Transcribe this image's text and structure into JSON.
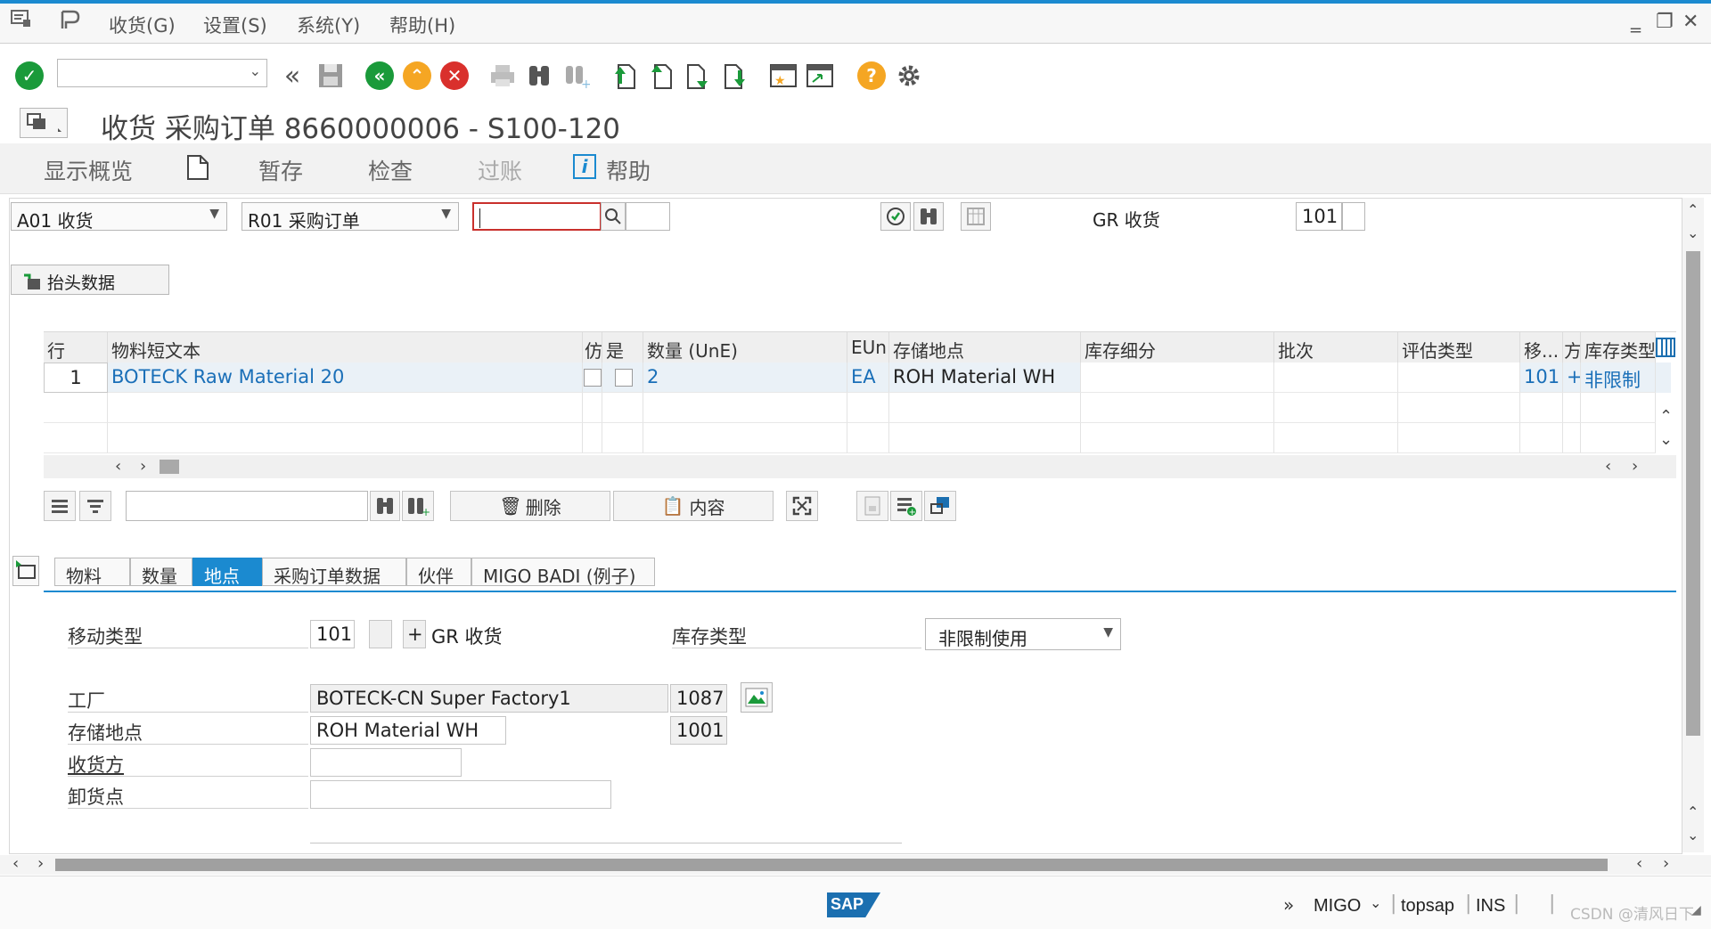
{
  "menu": {
    "items": [
      "收货(G)",
      "设置(S)",
      "系统(Y)",
      "帮助(H)"
    ]
  },
  "toolbar": {
    "command_value": "",
    "icons": [
      "enter-icon",
      "back-double-icon",
      "save-icon",
      "back-icon",
      "exit-icon",
      "cancel-icon",
      "print-icon",
      "find-icon",
      "find-next-icon",
      "first-page-icon",
      "prev-page-icon",
      "next-page-icon",
      "last-page-icon",
      "create-session-icon",
      "shortcut-icon",
      "help-icon",
      "settings-icon"
    ]
  },
  "title": "收货 采购订单 8660000006 - S100-120",
  "app_toolbar": {
    "overview": "显示概览",
    "hold": "暂存",
    "check": "检查",
    "post": "过账",
    "help": "帮助"
  },
  "selection": {
    "action": "A01 收货",
    "ref_doc": "R01 采购订单",
    "doc_number": "",
    "movement_label": "GR 收货",
    "movement_type": "101",
    "header_button": "抬头数据"
  },
  "table": {
    "columns": [
      "行",
      "物料短文本",
      "仿",
      "是",
      "数量 (UnE)",
      "EUn",
      "存储地点",
      "库存细分",
      "批次",
      "评估类型",
      "移...",
      "‌方",
      "库存类型"
    ],
    "rows": [
      {
        "line": "1",
        "material": "BOTECK Raw Material 20",
        "qty": "2",
        "unit": "EA",
        "sloc": "ROH Material WH",
        "stock_seg": "",
        "batch": "",
        "val_type": "",
        "mvt": "101",
        "sign": "+",
        "stock_type": "非限制"
      }
    ]
  },
  "table_toolbar": {
    "search_value": "",
    "delete": "删除",
    "content": "内容"
  },
  "tabs": [
    {
      "label": "物料",
      "active": false
    },
    {
      "label": "数量",
      "active": false
    },
    {
      "label": "地点",
      "active": true
    },
    {
      "label": "采购订单数据",
      "active": false
    },
    {
      "label": "伙伴",
      "active": false
    },
    {
      "label": "MIGO BADI (例子)",
      "active": false
    }
  ],
  "detail": {
    "mvt_label": "移动类型",
    "mvt_value": "101",
    "mvt_sign": "+",
    "mvt_text": "GR 收货",
    "stock_type_label": "库存类型",
    "stock_type_value": "非限制使用",
    "plant_label": "工厂",
    "plant_value": "BOTECK-CN Super Factory1",
    "plant_code": "1087",
    "sloc_label": "存储地点",
    "sloc_value": "ROH Material WH",
    "sloc_code": "1001",
    "recipient_label": "收货方",
    "recipient_value": "",
    "unload_label": "卸货点",
    "unload_value": ""
  },
  "status": {
    "logo": "SAP",
    "transaction": "MIGO",
    "server": "topsap",
    "mode": "INS",
    "watermark": "CSDN @清风日下"
  },
  "colors": {
    "accent": "#1b8ad0",
    "ok_green": "#1a9a3a",
    "cancel_red": "#d9302c",
    "back_orange": "#f5a623"
  }
}
